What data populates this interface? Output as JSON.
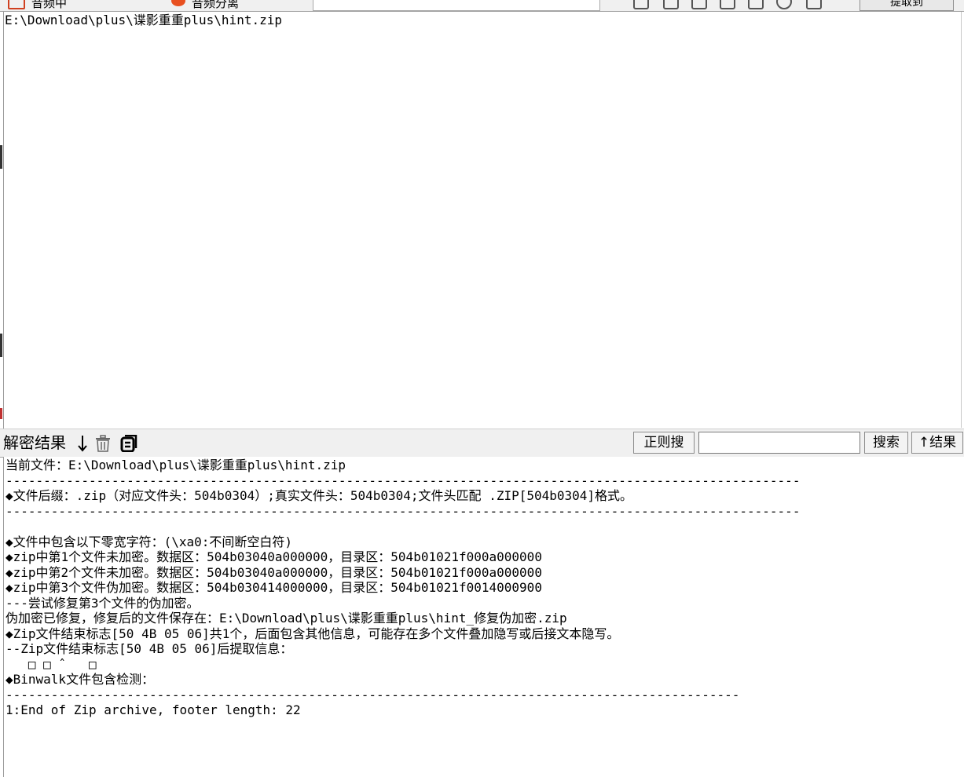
{
  "top_toolbar": {
    "tab1_text": "音频中",
    "tab2_text": "音频分离",
    "right_button": "提取到"
  },
  "input_area": {
    "path_text": "E:\\Download\\plus\\谍影重重plus\\hint.zip"
  },
  "result_bar": {
    "title": "解密结果",
    "icons": [
      "arrow-down-icon",
      "trash-icon",
      "copy-icon"
    ],
    "regex_button": "正则搜",
    "search_input_value": "",
    "search_button": "搜索",
    "up_results_button": "↑结果"
  },
  "output": {
    "lines": [
      "当前文件：E:\\Download\\plus\\谍影重重plus\\hint.zip",
      "---------------------------------------------------------------------------------------------------------",
      "◆文件后缀：.zip（对应文件头：504b0304）;真实文件头：504b0304;文件头匹配 .ZIP[504b0304]格式。",
      "---------------------------------------------------------------------------------------------------------",
      "",
      "◆文件中包含以下零宽字符：(\\xa0:不间断空白符)",
      "◆zip中第1个文件未加密。数据区：504b03040a000000，目录区：504b01021f000a000000",
      "◆zip中第2个文件未加密。数据区：504b03040a000000，目录区：504b01021f000a000000",
      "◆zip中第3个文件伪加密。数据区：504b030414000000，目录区：504b01021f0014000900",
      "---尝试修复第3个文件的伪加密。",
      "伪加密已修复，修复后的文件保存在：E:\\Download\\plus\\谍影重重plus\\hint_修复伪加密.zip",
      "◆Zip文件结束标志[50 4B 05 06]共1个，后面包含其他信息，可能存在多个文件叠加隐写或后接文本隐写。",
      "--Zip文件结束标志[50 4B 05 06]后提取信息：",
      "   □ □ ˆ   □",
      "◆Binwalk文件包含检测：",
      "-------------------------------------------------------------------------------------------------",
      "1:End of Zip archive, footer length: 22"
    ]
  }
}
